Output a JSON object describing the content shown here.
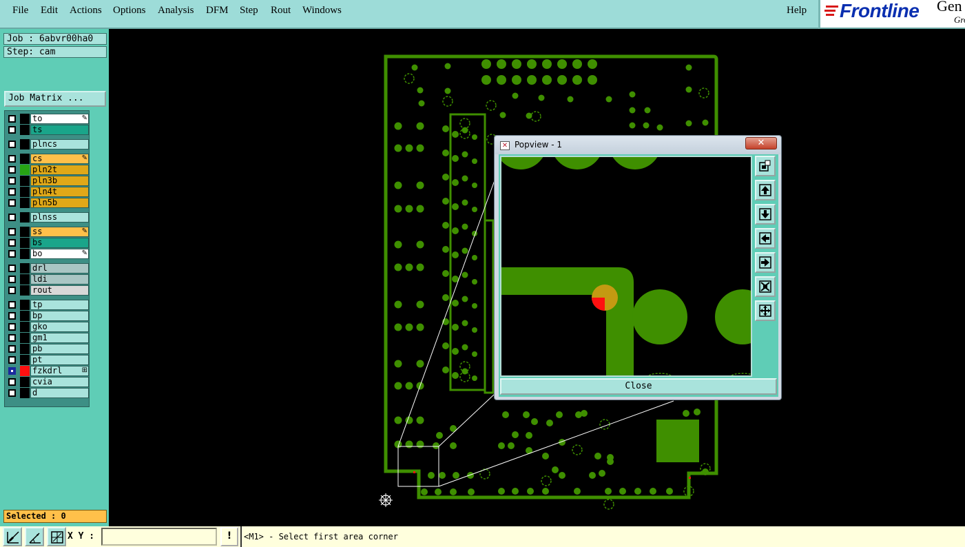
{
  "menubar": {
    "items": [
      "File",
      "Edit",
      "Actions",
      "Options",
      "Analysis",
      "DFM",
      "Step",
      "Rout",
      "Windows"
    ],
    "help": "Help"
  },
  "logo": {
    "brand": "Frontline",
    "product": "Gen",
    "sub": "Gro"
  },
  "job": {
    "job_label": "Job : 6abvr00ha0",
    "step_label": "Step: cam",
    "matrix_button": "Job Matrix ..."
  },
  "layers": [
    {
      "name": "to",
      "color": "#ffffff",
      "mark": "✎"
    },
    {
      "name": "ts",
      "color": "#1aa58a"
    },
    {
      "name": "plncs",
      "color": "#a9e3dc"
    },
    {
      "name": "cs",
      "color": "#ffc04a",
      "mark": "✎"
    },
    {
      "name": "pln2t",
      "color": "#e0a818",
      "swatch": "#27a314"
    },
    {
      "name": "pln3b",
      "color": "#e0a818"
    },
    {
      "name": "pln4t",
      "color": "#e0a818"
    },
    {
      "name": "pln5b",
      "color": "#e0a818"
    },
    {
      "name": "plnss",
      "color": "#a9e3dc"
    },
    {
      "name": "ss",
      "color": "#ffc04a",
      "mark": "✎"
    },
    {
      "name": "bs",
      "color": "#1aa58a"
    },
    {
      "name": "bo",
      "color": "#ffffff",
      "mark": "✎"
    },
    {
      "name": "drl",
      "color": "#a9c6c4"
    },
    {
      "name": "ldi",
      "color": "#a9c6c4"
    },
    {
      "name": "rout",
      "color": "#d8d8d8"
    },
    {
      "name": "tp",
      "color": "#a9e3dc"
    },
    {
      "name": "bp",
      "color": "#a9e3dc"
    },
    {
      "name": "gko",
      "color": "#a9e3dc"
    },
    {
      "name": "gm1",
      "color": "#a9e3dc"
    },
    {
      "name": "pb",
      "color": "#a9e3dc"
    },
    {
      "name": "pt",
      "color": "#a9e3dc"
    },
    {
      "name": "fzkdrl",
      "color": "#a9e3dc",
      "swatch": "#ff1010",
      "active": true,
      "mark": "⊞"
    },
    {
      "name": "cvia",
      "color": "#a9e3dc"
    },
    {
      "name": "d",
      "color": "#a9e3dc"
    }
  ],
  "selected": "Selected : 0",
  "popview": {
    "title": "Popview - 1",
    "close_label": "Close",
    "close_x": "✕"
  },
  "bottombar": {
    "xy_label": "X Y :",
    "xy_value": "",
    "status_button": "!",
    "status_text": "<M1> - Select first area corner"
  },
  "colors": {
    "accent": "#5fcdb6",
    "board_green": "#3f8f00",
    "highlight": "#ff1010"
  }
}
